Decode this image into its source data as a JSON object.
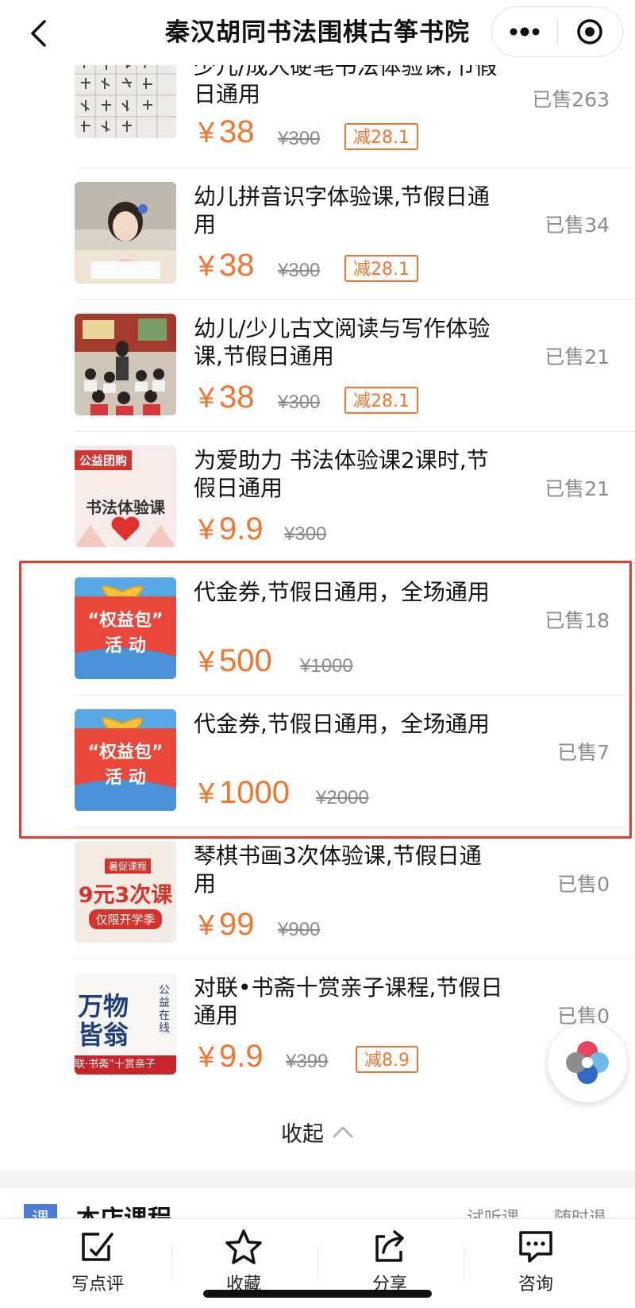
{
  "nav": {
    "title": "秦汉胡同书法围棋古筝书院"
  },
  "items": [
    {
      "title": "少儿/成人硬笔书法体验课,节假日通用",
      "price": "38",
      "original": "¥300",
      "badge": "减28.1",
      "sold": "已售263",
      "thumb": "calligraphy"
    },
    {
      "title": "幼儿拼音识字体验课,节假日通用",
      "price": "38",
      "original": "¥300",
      "badge": "减28.1",
      "sold": "已售34",
      "thumb": "child"
    },
    {
      "title": "幼儿/少儿古文阅读与写作体验课,节假日通用",
      "price": "38",
      "original": "¥300",
      "badge": "减28.1",
      "sold": "已售21",
      "thumb": "classroom"
    },
    {
      "title": "为爱助力 书法体验课2课时,节假日通用",
      "price": "9.9",
      "original": "¥300",
      "badge": "",
      "sold": "已售21",
      "thumb": "charity"
    },
    {
      "title": "代金券,节假日通用，全场通用",
      "price": "500",
      "original": "¥1000",
      "badge": "",
      "sold": "已售18",
      "thumb": "gift"
    },
    {
      "title": "代金券,节假日通用，全场通用",
      "price": "1000",
      "original": "¥2000",
      "badge": "",
      "sold": "已售7",
      "thumb": "gift"
    },
    {
      "title": "琴棋书画3次体验课,节假日通用",
      "price": "99",
      "original": "¥900",
      "badge": "",
      "sold": "已售0",
      "thumb": "promo"
    },
    {
      "title": "对联•书斋十赏亲子课程,节假日通用",
      "price": "9.9",
      "original": "¥399",
      "badge": "减8.9",
      "sold": "已售0",
      "thumb": "couplet"
    }
  ],
  "thumb_text": {
    "charity_tag": "公益团购",
    "charity_line": "书法体验课",
    "gift_line1": "“权益包”",
    "gift_line2": "活 动",
    "promo_top": "暑促课程",
    "promo_main": "9元3次课",
    "promo_sub": "仅限开学季",
    "couplet_main": "万物皆翁",
    "couplet_side": "公益在线",
    "couplet_bottom": "联·书斋”十赏亲子"
  },
  "currency": "¥",
  "collapse_label": "收起",
  "next_section": {
    "icon": "课",
    "title": "本店课程",
    "tags": "试听课　　随时退"
  },
  "tabs": [
    {
      "label": "写点评",
      "icon": "edit-icon"
    },
    {
      "label": "收藏",
      "icon": "star-icon"
    },
    {
      "label": "分享",
      "icon": "share-icon"
    },
    {
      "label": "咨询",
      "icon": "chat-icon"
    }
  ],
  "colors": {
    "accent": "#f2752f",
    "highlight": "#e43a32",
    "muted": "#8c8c8c"
  }
}
